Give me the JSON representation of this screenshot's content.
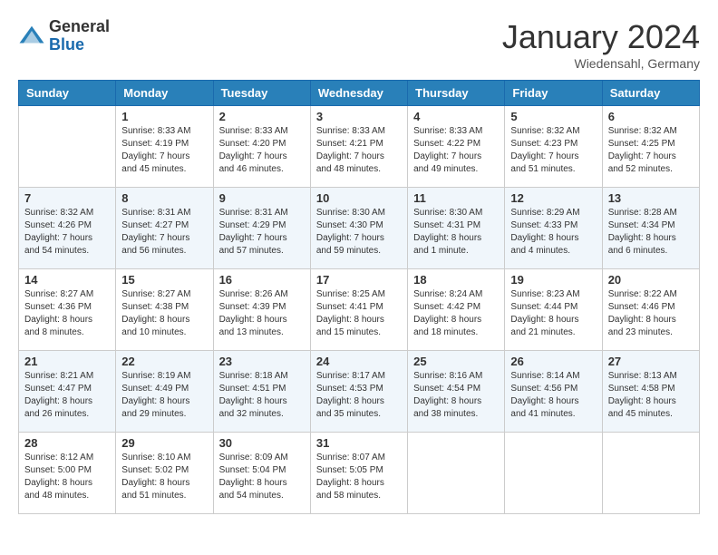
{
  "logo": {
    "general": "General",
    "blue": "Blue"
  },
  "title": "January 2024",
  "location": "Wiedensahl, Germany",
  "days_of_week": [
    "Sunday",
    "Monday",
    "Tuesday",
    "Wednesday",
    "Thursday",
    "Friday",
    "Saturday"
  ],
  "weeks": [
    [
      {
        "day": "",
        "sunrise": "",
        "sunset": "",
        "daylight": ""
      },
      {
        "day": "1",
        "sunrise": "Sunrise: 8:33 AM",
        "sunset": "Sunset: 4:19 PM",
        "daylight": "Daylight: 7 hours and 45 minutes."
      },
      {
        "day": "2",
        "sunrise": "Sunrise: 8:33 AM",
        "sunset": "Sunset: 4:20 PM",
        "daylight": "Daylight: 7 hours and 46 minutes."
      },
      {
        "day": "3",
        "sunrise": "Sunrise: 8:33 AM",
        "sunset": "Sunset: 4:21 PM",
        "daylight": "Daylight: 7 hours and 48 minutes."
      },
      {
        "day": "4",
        "sunrise": "Sunrise: 8:33 AM",
        "sunset": "Sunset: 4:22 PM",
        "daylight": "Daylight: 7 hours and 49 minutes."
      },
      {
        "day": "5",
        "sunrise": "Sunrise: 8:32 AM",
        "sunset": "Sunset: 4:23 PM",
        "daylight": "Daylight: 7 hours and 51 minutes."
      },
      {
        "day": "6",
        "sunrise": "Sunrise: 8:32 AM",
        "sunset": "Sunset: 4:25 PM",
        "daylight": "Daylight: 7 hours and 52 minutes."
      }
    ],
    [
      {
        "day": "7",
        "sunrise": "Sunrise: 8:32 AM",
        "sunset": "Sunset: 4:26 PM",
        "daylight": "Daylight: 7 hours and 54 minutes."
      },
      {
        "day": "8",
        "sunrise": "Sunrise: 8:31 AM",
        "sunset": "Sunset: 4:27 PM",
        "daylight": "Daylight: 7 hours and 56 minutes."
      },
      {
        "day": "9",
        "sunrise": "Sunrise: 8:31 AM",
        "sunset": "Sunset: 4:29 PM",
        "daylight": "Daylight: 7 hours and 57 minutes."
      },
      {
        "day": "10",
        "sunrise": "Sunrise: 8:30 AM",
        "sunset": "Sunset: 4:30 PM",
        "daylight": "Daylight: 7 hours and 59 minutes."
      },
      {
        "day": "11",
        "sunrise": "Sunrise: 8:30 AM",
        "sunset": "Sunset: 4:31 PM",
        "daylight": "Daylight: 8 hours and 1 minute."
      },
      {
        "day": "12",
        "sunrise": "Sunrise: 8:29 AM",
        "sunset": "Sunset: 4:33 PM",
        "daylight": "Daylight: 8 hours and 4 minutes."
      },
      {
        "day": "13",
        "sunrise": "Sunrise: 8:28 AM",
        "sunset": "Sunset: 4:34 PM",
        "daylight": "Daylight: 8 hours and 6 minutes."
      }
    ],
    [
      {
        "day": "14",
        "sunrise": "Sunrise: 8:27 AM",
        "sunset": "Sunset: 4:36 PM",
        "daylight": "Daylight: 8 hours and 8 minutes."
      },
      {
        "day": "15",
        "sunrise": "Sunrise: 8:27 AM",
        "sunset": "Sunset: 4:38 PM",
        "daylight": "Daylight: 8 hours and 10 minutes."
      },
      {
        "day": "16",
        "sunrise": "Sunrise: 8:26 AM",
        "sunset": "Sunset: 4:39 PM",
        "daylight": "Daylight: 8 hours and 13 minutes."
      },
      {
        "day": "17",
        "sunrise": "Sunrise: 8:25 AM",
        "sunset": "Sunset: 4:41 PM",
        "daylight": "Daylight: 8 hours and 15 minutes."
      },
      {
        "day": "18",
        "sunrise": "Sunrise: 8:24 AM",
        "sunset": "Sunset: 4:42 PM",
        "daylight": "Daylight: 8 hours and 18 minutes."
      },
      {
        "day": "19",
        "sunrise": "Sunrise: 8:23 AM",
        "sunset": "Sunset: 4:44 PM",
        "daylight": "Daylight: 8 hours and 21 minutes."
      },
      {
        "day": "20",
        "sunrise": "Sunrise: 8:22 AM",
        "sunset": "Sunset: 4:46 PM",
        "daylight": "Daylight: 8 hours and 23 minutes."
      }
    ],
    [
      {
        "day": "21",
        "sunrise": "Sunrise: 8:21 AM",
        "sunset": "Sunset: 4:47 PM",
        "daylight": "Daylight: 8 hours and 26 minutes."
      },
      {
        "day": "22",
        "sunrise": "Sunrise: 8:19 AM",
        "sunset": "Sunset: 4:49 PM",
        "daylight": "Daylight: 8 hours and 29 minutes."
      },
      {
        "day": "23",
        "sunrise": "Sunrise: 8:18 AM",
        "sunset": "Sunset: 4:51 PM",
        "daylight": "Daylight: 8 hours and 32 minutes."
      },
      {
        "day": "24",
        "sunrise": "Sunrise: 8:17 AM",
        "sunset": "Sunset: 4:53 PM",
        "daylight": "Daylight: 8 hours and 35 minutes."
      },
      {
        "day": "25",
        "sunrise": "Sunrise: 8:16 AM",
        "sunset": "Sunset: 4:54 PM",
        "daylight": "Daylight: 8 hours and 38 minutes."
      },
      {
        "day": "26",
        "sunrise": "Sunrise: 8:14 AM",
        "sunset": "Sunset: 4:56 PM",
        "daylight": "Daylight: 8 hours and 41 minutes."
      },
      {
        "day": "27",
        "sunrise": "Sunrise: 8:13 AM",
        "sunset": "Sunset: 4:58 PM",
        "daylight": "Daylight: 8 hours and 45 minutes."
      }
    ],
    [
      {
        "day": "28",
        "sunrise": "Sunrise: 8:12 AM",
        "sunset": "Sunset: 5:00 PM",
        "daylight": "Daylight: 8 hours and 48 minutes."
      },
      {
        "day": "29",
        "sunrise": "Sunrise: 8:10 AM",
        "sunset": "Sunset: 5:02 PM",
        "daylight": "Daylight: 8 hours and 51 minutes."
      },
      {
        "day": "30",
        "sunrise": "Sunrise: 8:09 AM",
        "sunset": "Sunset: 5:04 PM",
        "daylight": "Daylight: 8 hours and 54 minutes."
      },
      {
        "day": "31",
        "sunrise": "Sunrise: 8:07 AM",
        "sunset": "Sunset: 5:05 PM",
        "daylight": "Daylight: 8 hours and 58 minutes."
      },
      {
        "day": "",
        "sunrise": "",
        "sunset": "",
        "daylight": ""
      },
      {
        "day": "",
        "sunrise": "",
        "sunset": "",
        "daylight": ""
      },
      {
        "day": "",
        "sunrise": "",
        "sunset": "",
        "daylight": ""
      }
    ]
  ]
}
